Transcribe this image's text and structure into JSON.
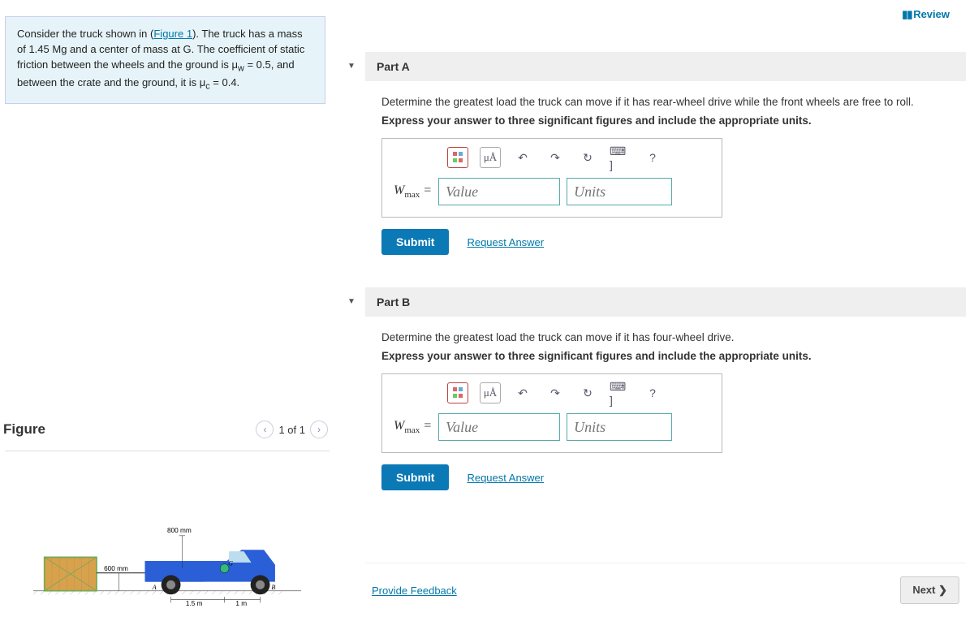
{
  "review": "Review",
  "problem": {
    "text_pre": "Consider the truck shown in (",
    "figure_link": "Figure 1",
    "text_mid": "). The truck has a mass of 1.45 Mg and a center of mass at G. The coefficient of static friction between the wheels and the ground is μ",
    "sub1": "w",
    "text_mid2": " = 0.5, and between the crate and the ground, it is μ",
    "sub2": "c",
    "text_end": " = 0.4."
  },
  "figure": {
    "title": "Figure",
    "pager": "1 of 1",
    "dims": {
      "h1": "800 mm",
      "h2": "600 mm",
      "d1": "1.5 m",
      "d2": "1 m"
    },
    "labels": {
      "A": "A",
      "B": "B",
      "G": "G"
    }
  },
  "parts": [
    {
      "key": "a",
      "title": "Part A",
      "prompt1": "Determine the greatest load the truck can move if it has rear-wheel drive while the front wheels are free to roll.",
      "prompt2": "Express your answer to three significant figures and include the appropriate units.",
      "var_label": "W",
      "var_sub": "max",
      "value_placeholder": "Value",
      "units_placeholder": "Units",
      "submit": "Submit",
      "request": "Request Answer"
    },
    {
      "key": "b",
      "title": "Part B",
      "prompt1": "Determine the greatest load the truck can move if it has four-wheel drive.",
      "prompt2": "Express your answer to three significant figures and include the appropriate units.",
      "var_label": "W",
      "var_sub": "max",
      "value_placeholder": "Value",
      "units_placeholder": "Units",
      "submit": "Submit",
      "request": "Request Answer"
    }
  ],
  "toolbar": {
    "frac_label": "▭/▭",
    "mu_label": "μÅ",
    "help_label": "?",
    "keyb_label": "⌨ ]"
  },
  "footer": {
    "feedback": "Provide Feedback",
    "next": "Next ❯"
  }
}
